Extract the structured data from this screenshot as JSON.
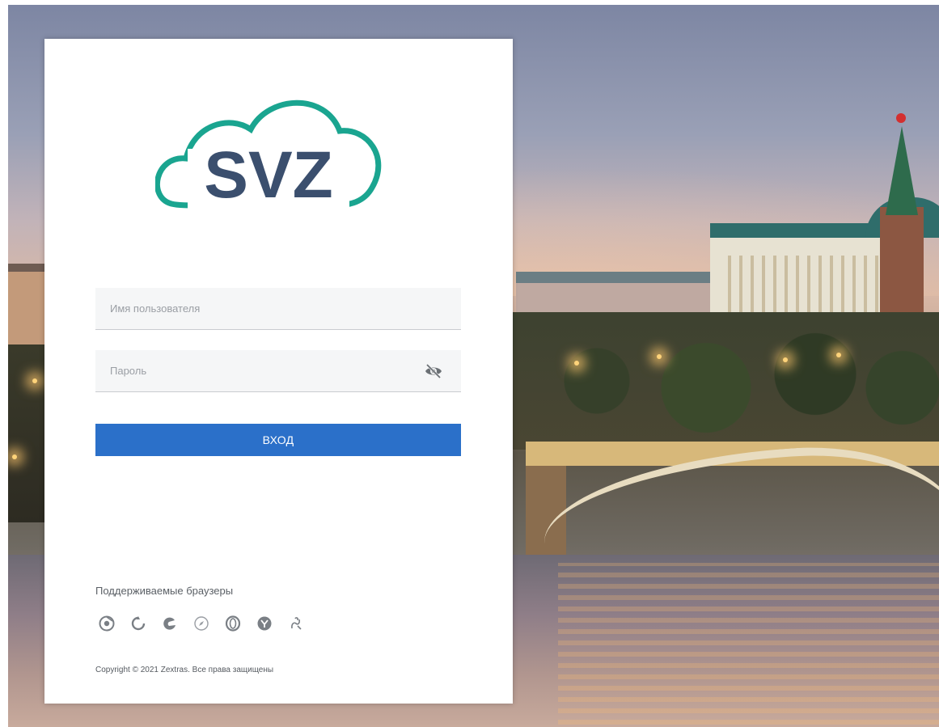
{
  "background": {
    "description_icon": "moscow-kremlin-photo"
  },
  "logo": {
    "text": "SVZ",
    "text_color": "#3b4f6e",
    "cloud_color": "#1aa590"
  },
  "login": {
    "username_placeholder": "Имя пользователя",
    "password_placeholder": "Пароль",
    "password_toggle_icon": "eye-slash-icon",
    "submit_label": "ВХОД",
    "submit_color": "#2b70c9"
  },
  "footer": {
    "browsers_title": "Поддерживаемые браузеры",
    "browsers": [
      "chrome-icon",
      "firefox-icon",
      "edge-icon",
      "safari-icon",
      "opera-icon",
      "yandex-icon",
      "brand-icon"
    ],
    "copyright": "Copyright © 2021 Zextras. Все права защищены"
  }
}
